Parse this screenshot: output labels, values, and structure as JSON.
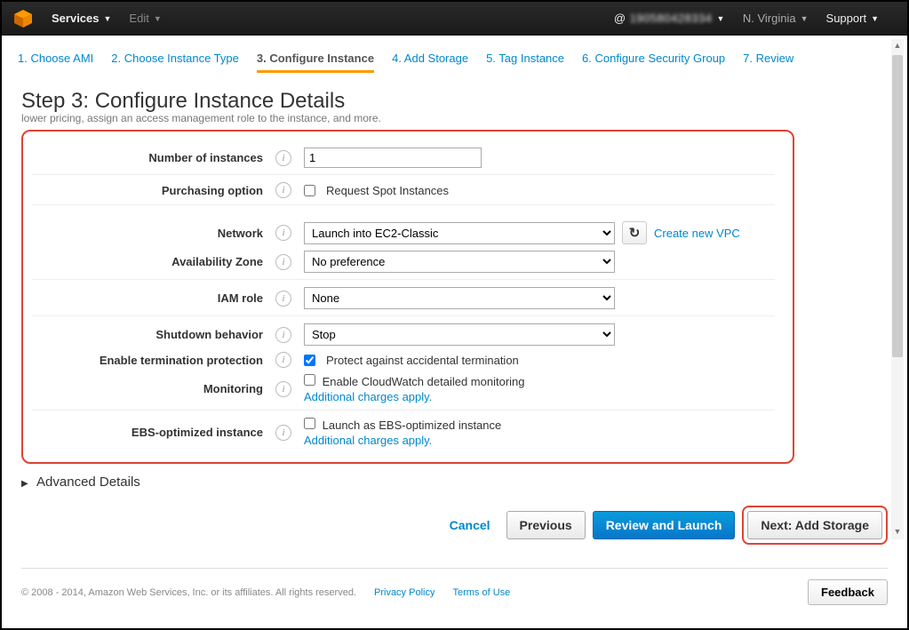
{
  "topbar": {
    "services": "Services",
    "edit": "Edit",
    "account_prefix": "@",
    "account_id": "190580428334",
    "region": "N. Virginia",
    "support": "Support"
  },
  "wizard": [
    {
      "label": "1. Choose AMI"
    },
    {
      "label": "2. Choose Instance Type"
    },
    {
      "label": "3. Configure Instance"
    },
    {
      "label": "4. Add Storage"
    },
    {
      "label": "5. Tag Instance"
    },
    {
      "label": "6. Configure Security Group"
    },
    {
      "label": "7. Review"
    }
  ],
  "title": "Step 3: Configure Instance Details",
  "subtitle": "lower pricing, assign an access management role to the instance, and more.",
  "form": {
    "num_instances": {
      "label": "Number of instances",
      "value": "1"
    },
    "purchasing": {
      "label": "Purchasing option",
      "text": "Request Spot Instances",
      "checked": false
    },
    "network": {
      "label": "Network",
      "value": "Launch into EC2-Classic",
      "link": "Create new VPC"
    },
    "az": {
      "label": "Availability Zone",
      "value": "No preference"
    },
    "iam": {
      "label": "IAM role",
      "value": "None"
    },
    "shutdown": {
      "label": "Shutdown behavior",
      "value": "Stop"
    },
    "term_prot": {
      "label": "Enable termination protection",
      "text": "Protect against accidental termination",
      "checked": true
    },
    "monitoring": {
      "label": "Monitoring",
      "text": "Enable CloudWatch detailed monitoring",
      "link": "Additional charges apply.",
      "checked": false
    },
    "ebs": {
      "label": "EBS-optimized instance",
      "text": "Launch as EBS-optimized instance",
      "link": "Additional charges apply.",
      "checked": false
    }
  },
  "advanced": "Advanced Details",
  "buttons": {
    "cancel": "Cancel",
    "previous": "Previous",
    "review": "Review and Launch",
    "next": "Next: Add Storage"
  },
  "legal": {
    "copyright": "© 2008 - 2014, Amazon Web Services, Inc. or its affiliates. All rights reserved.",
    "privacy": "Privacy Policy",
    "terms": "Terms of Use",
    "feedback": "Feedback"
  }
}
